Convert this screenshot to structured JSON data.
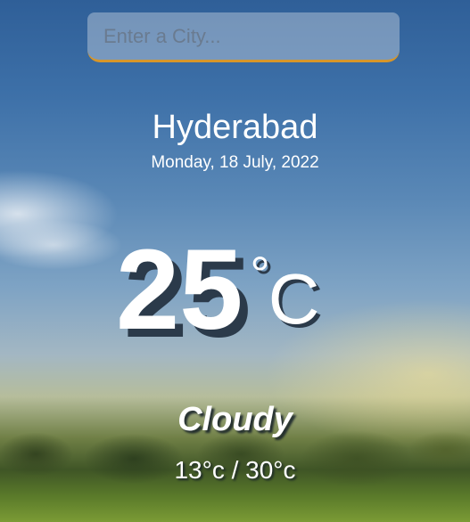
{
  "search": {
    "placeholder": "Enter a City...",
    "value": ""
  },
  "location": {
    "city": "Hyderabad",
    "date": "Monday, 18 July, 2022"
  },
  "weather": {
    "temperature": "25",
    "degree_symbol": "°",
    "unit": "C",
    "condition": "Cloudy",
    "min_max": "13°c / 30°c"
  },
  "colors": {
    "search_border_accent": "#d7962a",
    "text": "#ffffff",
    "temp_shadow": "#2b3a4a"
  },
  "background": {
    "icon": "sky-landscape-background"
  }
}
